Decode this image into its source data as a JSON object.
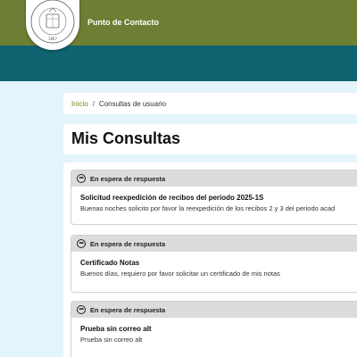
{
  "header": {
    "app_title": "Punto de Contacto",
    "logo": {
      "name": "universidad-nacional-de-colombia-seal",
      "arc_text": "UNIVERSIDAD NACIONAL DE COLOMBIA",
      "year": "1867"
    },
    "colors": {
      "top": "#6e7e34",
      "band": "#0f6270",
      "page_bg": "#e4f4fb"
    }
  },
  "breadcrumb": {
    "home": "Inicio",
    "separator": "/",
    "current": "Consultas de usuario"
  },
  "page": {
    "title": "Mis Consultas"
  },
  "consultas": [
    {
      "status": "En espera de respuesta",
      "status_icon": "ellipsis-circle-icon",
      "title": "Solicitud reexpedición de recibos del periodo 2025-1S",
      "description": "Buenas noches solicito por favor la reexpedición de los recibos 2 y 3 del periodo acad"
    },
    {
      "status": "En espera de respuesta",
      "status_icon": "ellipsis-circle-icon",
      "title": "Certificado Notas",
      "description": "Buenos días, requiero por favor solicitar un certificado de mis notas"
    },
    {
      "status": "En espera de respuesta",
      "status_icon": "ellipsis-circle-icon",
      "title": "Prueba sin correo alt",
      "description": "Prueba sin correo alt"
    }
  ]
}
